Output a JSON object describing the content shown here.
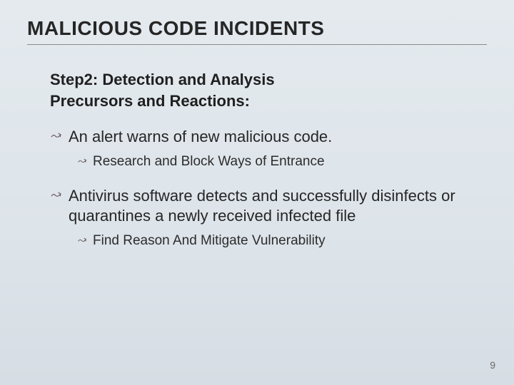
{
  "title": "MALICIOUS CODE INCIDENTS",
  "subhead1": "Step2: Detection and Analysis",
  "subhead2": "Precursors and Reactions:",
  "bullets": [
    {
      "text": "An alert warns of new malicious code.",
      "sub": [
        {
          "text": "Research and Block Ways of Entrance"
        }
      ]
    },
    {
      "text": "Antivirus software detects and successfully disinfects or quarantines a newly received infected file",
      "sub": [
        {
          "text": "Find Reason And Mitigate Vulnerability"
        }
      ]
    }
  ],
  "page_number": "9",
  "icons": {
    "bullet": "script-bullet-icon"
  }
}
